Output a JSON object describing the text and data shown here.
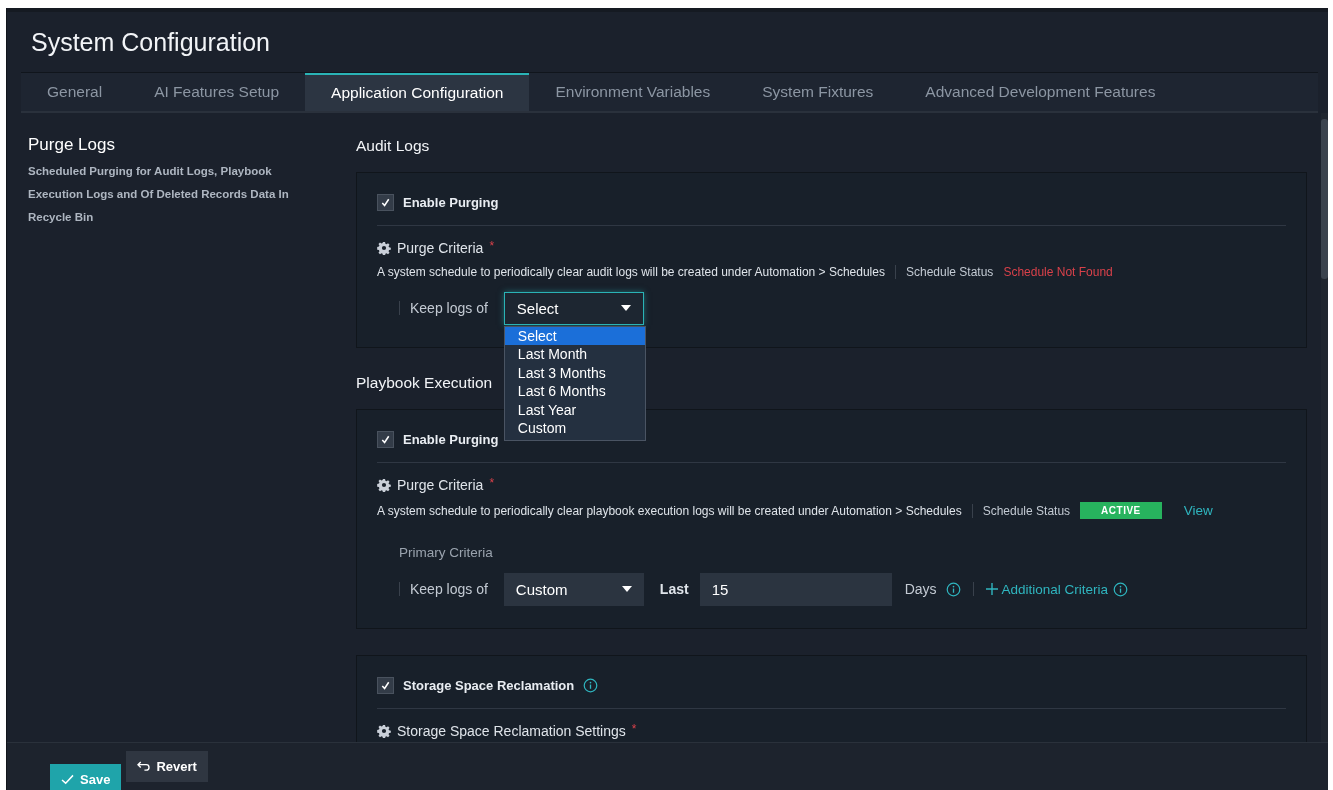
{
  "window": {
    "title": "System Configuration"
  },
  "tabs": [
    {
      "label": "General",
      "selected": false
    },
    {
      "label": "AI Features Setup",
      "selected": false
    },
    {
      "label": "Application Configuration",
      "selected": true
    },
    {
      "label": "Environment Variables",
      "selected": false
    },
    {
      "label": "System Fixtures",
      "selected": false
    },
    {
      "label": "Advanced Development Features",
      "selected": false
    }
  ],
  "sidebar": {
    "title": "Purge Logs",
    "description": "Scheduled Purging for Audit Logs, Playbook Execution Logs and Of Deleted Records Data In Recycle Bin"
  },
  "sections": [
    {
      "heading": "Audit Logs",
      "enable": {
        "label": "Enable Purging",
        "checked": true
      },
      "criteria": {
        "label": "Purge Criteria",
        "required_mark": "*",
        "note": "A system schedule to periodically clear audit logs will be created under Automation > Schedules",
        "status_label": "Schedule Status",
        "status": {
          "kind": "error",
          "text": "Schedule Not Found"
        }
      },
      "keep": {
        "label": "Keep logs of",
        "value": "Select",
        "open": true,
        "options": [
          {
            "label": "Select",
            "selected": true
          },
          {
            "label": "Last Month",
            "selected": false
          },
          {
            "label": "Last 3 Months",
            "selected": false
          },
          {
            "label": "Last 6 Months",
            "selected": false
          },
          {
            "label": "Last Year",
            "selected": false
          },
          {
            "label": "Custom",
            "selected": false
          }
        ]
      }
    },
    {
      "heading": "Playbook Execution",
      "enable": {
        "label": "Enable Purging",
        "checked": true
      },
      "criteria": {
        "label": "Purge Criteria",
        "required_mark": "*",
        "note": "A system schedule to periodically clear playbook execution logs will be created under Automation > Schedules",
        "status_label": "Schedule Status",
        "status": {
          "kind": "badge",
          "text": "ACTIVE"
        },
        "link": "View"
      },
      "primary_label": "Primary Criteria",
      "keep": {
        "label": "Keep logs of",
        "value": "Custom",
        "open": false,
        "last_label": "Last",
        "days": "15",
        "unit": "Days",
        "additional": "Additional Criteria"
      }
    },
    {
      "enable": {
        "label": "Storage Space Reclamation",
        "checked": true,
        "info": true
      },
      "criteria": {
        "label": "Storage Space Reclamation Settings",
        "required_mark": "*"
      }
    }
  ],
  "footer": {
    "buttons": [
      {
        "label": "Save",
        "kind": "primary"
      },
      {
        "label": "Revert",
        "kind": "secondary"
      }
    ]
  }
}
